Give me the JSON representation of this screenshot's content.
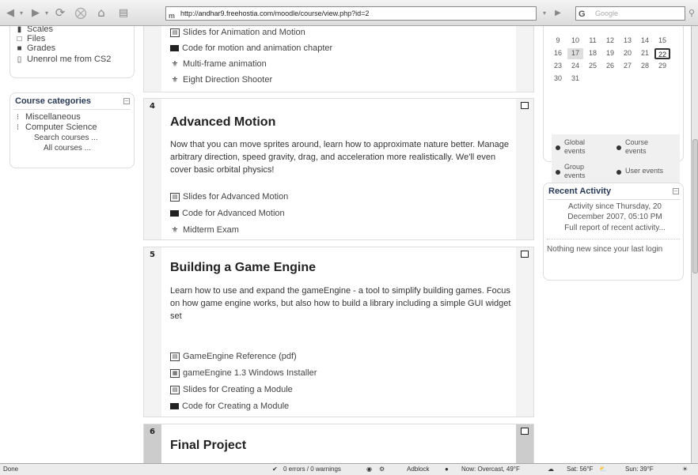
{
  "browser": {
    "url": "http://andhar9.freehostia.com/moodle/course/view.php?id=2",
    "search_placeholder": "Google",
    "search_engine_glyph": "G"
  },
  "left_nav": {
    "items": [
      "Scales",
      "Files",
      "Grades",
      "Unenrol me from CS2"
    ]
  },
  "course_categories": {
    "title": "Course categories",
    "items": [
      "Miscellaneous",
      "Computer Science"
    ],
    "search_link": "Search courses ...",
    "all_link": "All courses ..."
  },
  "sections": {
    "s3": {
      "activities": [
        "Slides for Animation and Motion",
        "Code for motion and animation chapter",
        "Multi-frame animation",
        "Eight Direction Shooter"
      ]
    },
    "s4": {
      "number": "4",
      "title": "Advanced Motion",
      "summary": "Now that you can move sprites around, learn how to approximate nature better. Manage arbitrary direction, speed gravity, drag, and acceleration more realistically. We'll even cover basic orbital physics!",
      "activities": [
        "Slides for Advanced Motion",
        "Code for Advanced Motion",
        "Midterm Exam"
      ]
    },
    "s5": {
      "number": "5",
      "title": "Building a Game Engine",
      "summary": "Learn how to use and expand the gameEngine - a tool to simplify building games. Focus on how game engine works, but also how to build a library including a simple GUI widget set",
      "activities": [
        "GameEngine Reference (pdf)",
        "gameEngine 1.3 Windows Installer",
        "Slides for Creating a Module",
        "Code for Creating a Module"
      ]
    },
    "s6": {
      "number": "6",
      "title": "Final Project"
    }
  },
  "calendar": {
    "rows": [
      [
        "9",
        "10",
        "11",
        "12",
        "13",
        "14",
        "15"
      ],
      [
        "16",
        "17",
        "18",
        "19",
        "20",
        "21",
        "22"
      ],
      [
        "23",
        "24",
        "25",
        "26",
        "27",
        "28",
        "29"
      ],
      [
        "30",
        "31"
      ]
    ],
    "today": "17",
    "selected": "22",
    "legend": {
      "global": "Global events",
      "course": "Course events",
      "group": "Group events",
      "user": "User events"
    }
  },
  "recent_activity": {
    "title": "Recent Activity",
    "since": "Activity since Thursday, 20 December 2007, 05:10 PM",
    "full_report": "Full report of recent activity...",
    "nothing_new": "Nothing new since your last login"
  },
  "status_bar": {
    "status": "Done",
    "errors": "0 errors / 0 warnings",
    "adblock": "Adblock",
    "weather_now": "Now: Overcast, 49°F",
    "weather_sat": "Sat: 56°F",
    "weather_sun": "Sun: 39°F"
  },
  "colors": {
    "block_title": "#2a3b57",
    "section_side": "#f3f3f3",
    "chrome": "#dcdcdc"
  }
}
